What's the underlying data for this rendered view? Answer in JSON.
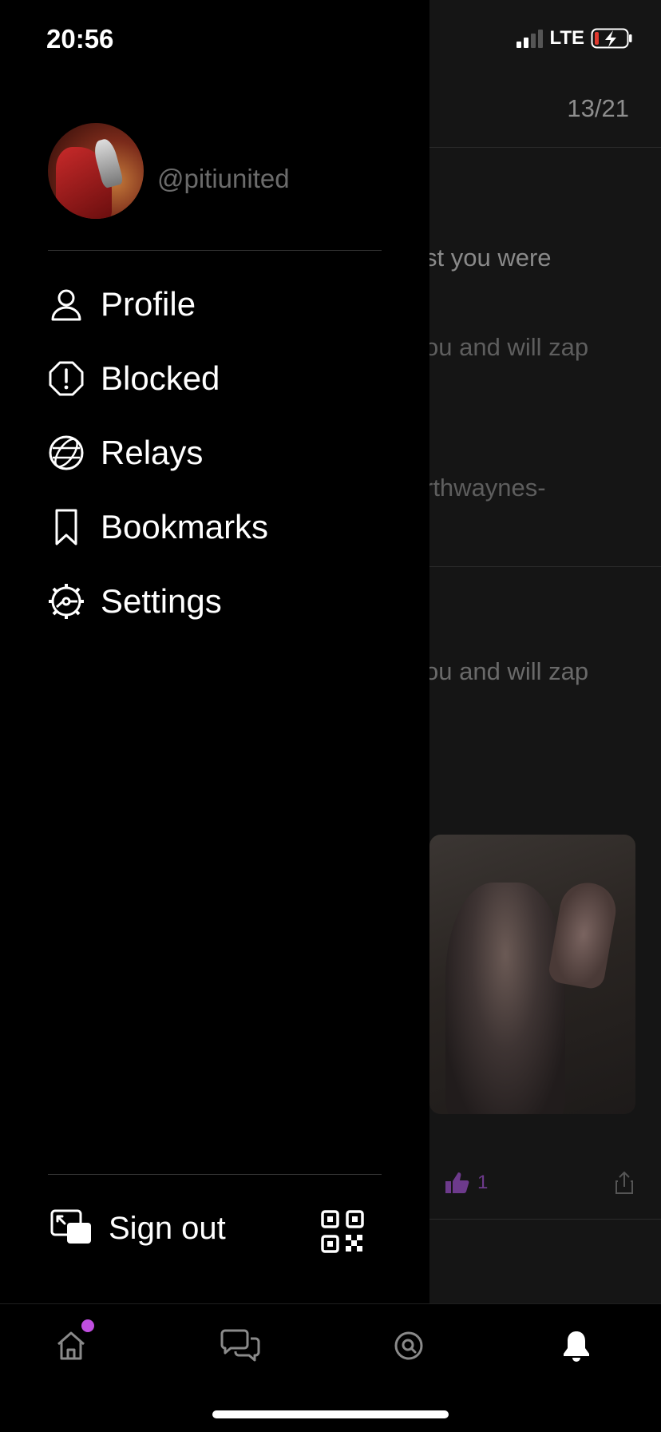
{
  "status_bar": {
    "time": "20:56",
    "network": "LTE"
  },
  "background_feed": {
    "counter": "13/21",
    "snippets": [
      "st you were",
      "ou and will zap",
      "rthwaynes-",
      "ou and will zap"
    ],
    "like_count": "1"
  },
  "drawer": {
    "username": "@pitiunited",
    "menu": [
      {
        "label": "Profile",
        "icon": "person-icon"
      },
      {
        "label": "Blocked",
        "icon": "blocked-icon"
      },
      {
        "label": "Relays",
        "icon": "globe-icon"
      },
      {
        "label": "Bookmarks",
        "icon": "bookmark-icon"
      },
      {
        "label": "Settings",
        "icon": "gear-icon"
      }
    ],
    "sign_out_label": "Sign out"
  },
  "tab_bar": {
    "tabs": [
      "home-icon",
      "messages-icon",
      "search-icon",
      "notifications-icon"
    ],
    "active_tab": "notifications-icon"
  },
  "colors": {
    "accent": "#c04ee0",
    "background": "#000000",
    "muted_text": "#6b6b6b"
  }
}
